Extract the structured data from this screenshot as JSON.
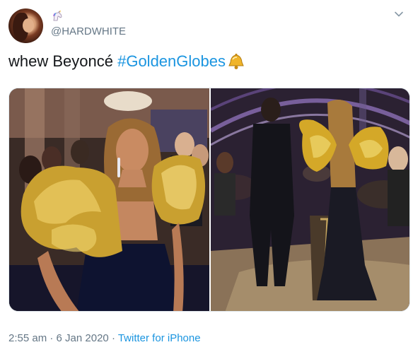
{
  "author": {
    "display_name_emoji": "unicorn-emoji",
    "handle": "@HARDWHITE"
  },
  "tweet": {
    "text_plain": "whew Beyoncé ",
    "hashtag": "#GoldenGlobes",
    "emoji": "bell-emoji"
  },
  "meta": {
    "time": "2:55 am",
    "separator1": " · ",
    "date": "6 Jan 2020",
    "separator2": " · ",
    "source": "Twitter for iPhone"
  },
  "colors": {
    "link": "#1b95e0",
    "secondary_text": "#657786",
    "primary_text": "#14171a",
    "gold": "#d4a828"
  }
}
